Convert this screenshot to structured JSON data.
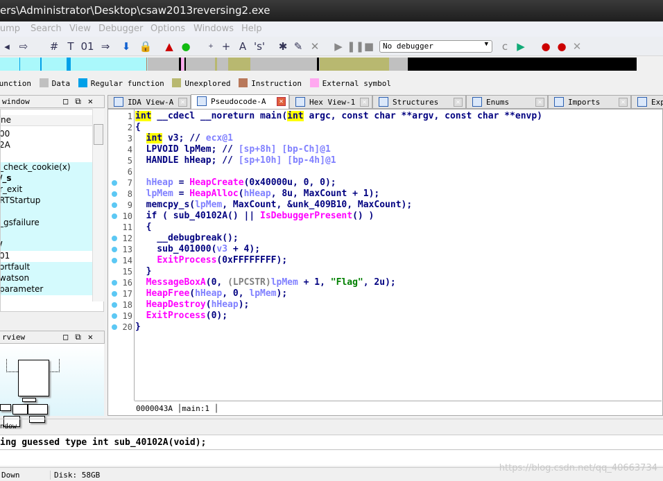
{
  "window": {
    "title": "ers\\Administrator\\Desktop\\csaw2013reversing2.exe"
  },
  "menu": [
    "Jump",
    "Search",
    "View",
    "Debugger",
    "Options",
    "Windows",
    "Help"
  ],
  "toolbar": {
    "debugger_select": "No debugger"
  },
  "legend": [
    {
      "label": "Function",
      "color": "#aaf8fb"
    },
    {
      "label": "Data",
      "color": "#c0c0c0"
    },
    {
      "label": "Regular function",
      "color": "#00a0e8"
    },
    {
      "label": "Unexplored",
      "color": "#b8b870"
    },
    {
      "label": "Instruction",
      "color": "#b8785a"
    },
    {
      "label": "External symbol",
      "color": "#ffa8f0"
    }
  ],
  "functions_window": {
    "title": "window",
    "column": "ne",
    "rows": [
      "00",
      "2A",
      "",
      "_check_cookie(x)",
      "/_s",
      "r_exit",
      "RTStartup",
      "",
      "_gsfailure",
      "",
      "/",
      "01",
      "ortfault",
      "watson",
      "parameter"
    ]
  },
  "graph_overview": {
    "title": "rview"
  },
  "tabs": [
    {
      "label": "IDA View-A"
    },
    {
      "label": "Pseudocode-A",
      "active": true
    },
    {
      "label": "Hex View-1"
    },
    {
      "label": "Structures"
    },
    {
      "label": "Enums"
    },
    {
      "label": "Imports"
    },
    {
      "label": "Exports"
    }
  ],
  "code": {
    "lines": [
      [
        [
          "k",
          "int"
        ],
        [
          "n",
          " __cdecl __noreturn main("
        ],
        [
          "k",
          "int"
        ],
        [
          "n",
          " argc, const char **argv, const char **envp)"
        ]
      ],
      [
        [
          "n",
          "{"
        ]
      ],
      [
        [
          "n",
          "  "
        ],
        [
          "k",
          "int"
        ],
        [
          "n",
          " v3; // "
        ],
        [
          "c",
          "ecx@1"
        ]
      ],
      [
        [
          "n",
          "  LPVOID lpMem; // "
        ],
        [
          "c",
          "[sp+8h] [bp-Ch]@1"
        ]
      ],
      [
        [
          "n",
          "  HANDLE hHeap; // "
        ],
        [
          "c",
          "[sp+10h] [bp-4h]@1"
        ]
      ],
      [],
      [
        [
          "n",
          "  "
        ],
        [
          "v",
          "hHeap"
        ],
        [
          "n",
          " = "
        ],
        [
          "f",
          "HeapCreate"
        ],
        [
          "n",
          "(0x40000u, 0, 0);"
        ]
      ],
      [
        [
          "n",
          "  "
        ],
        [
          "v",
          "lpMem"
        ],
        [
          "n",
          " = "
        ],
        [
          "f",
          "HeapAlloc"
        ],
        [
          "n",
          "("
        ],
        [
          "v",
          "hHeap"
        ],
        [
          "n",
          ", 8u, MaxCount + 1);"
        ]
      ],
      [
        [
          "n",
          "  memcpy_s("
        ],
        [
          "v",
          "lpMem"
        ],
        [
          "n",
          ", MaxCount, &unk_409B10, MaxCount);"
        ]
      ],
      [
        [
          "n",
          "  if ( sub_40102A() || "
        ],
        [
          "f",
          "IsDebuggerPresent"
        ],
        [
          "n",
          "() )"
        ]
      ],
      [
        [
          "n",
          "  {"
        ]
      ],
      [
        [
          "n",
          "    __debugbreak();"
        ]
      ],
      [
        [
          "n",
          "    sub_401000("
        ],
        [
          "v",
          "v3"
        ],
        [
          "n",
          " + 4);"
        ]
      ],
      [
        [
          "n",
          "    "
        ],
        [
          "f",
          "ExitProcess"
        ],
        [
          "n",
          "(0xFFFFFFFF);"
        ]
      ],
      [
        [
          "n",
          "  }"
        ]
      ],
      [
        [
          "n",
          "  "
        ],
        [
          "f",
          "MessageBoxA"
        ],
        [
          "n",
          "(0, "
        ],
        [
          "t",
          "(LPCSTR)"
        ],
        [
          "v",
          "lpMem"
        ],
        [
          "n",
          " + 1, "
        ],
        [
          "s",
          "\"Flag\""
        ],
        [
          "n",
          ", 2u);"
        ]
      ],
      [
        [
          "n",
          "  "
        ],
        [
          "f",
          "HeapFree"
        ],
        [
          "n",
          "("
        ],
        [
          "v",
          "hHeap"
        ],
        [
          "n",
          ", 0, "
        ],
        [
          "v",
          "lpMem"
        ],
        [
          "n",
          ");"
        ]
      ],
      [
        [
          "n",
          "  "
        ],
        [
          "f",
          "HeapDestroy"
        ],
        [
          "n",
          "("
        ],
        [
          "v",
          "hHeap"
        ],
        [
          "n",
          ");"
        ]
      ],
      [
        [
          "n",
          "  "
        ],
        [
          "f",
          "ExitProcess"
        ],
        [
          "n",
          "(0);"
        ]
      ],
      [
        [
          "n",
          "}"
        ]
      ]
    ],
    "breakpoint_lines": [
      7,
      8,
      9,
      10,
      12,
      13,
      14,
      16,
      17,
      18,
      19,
      20
    ],
    "status_address": "0000043A",
    "status_func": "main:1"
  },
  "output": {
    "title": "ndow",
    "text": "ing guessed type int sub_40102A(void);"
  },
  "statusbar": {
    "state": "Down",
    "disk": "Disk: 58GB"
  },
  "watermark": "https://blog.csdn.net/qq_40663734"
}
